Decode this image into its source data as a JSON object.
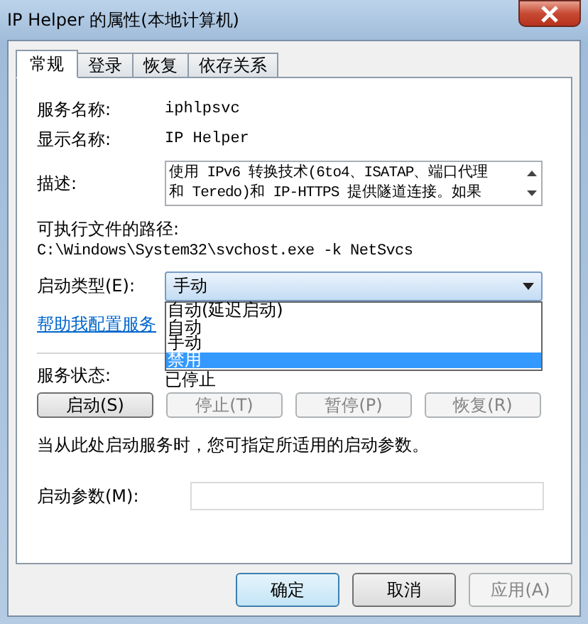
{
  "window": {
    "title": "IP Helper 的属性(本地计算机)"
  },
  "tabs": [
    {
      "label": "常规",
      "selected": true
    },
    {
      "label": "登录",
      "selected": false
    },
    {
      "label": "恢复",
      "selected": false
    },
    {
      "label": "依存关系",
      "selected": false
    }
  ],
  "service_name": {
    "label": "服务名称:",
    "value": "iphlpsvc"
  },
  "display_name": {
    "label": "显示名称:",
    "value": "IP Helper"
  },
  "description": {
    "label": "描述:",
    "lines": [
      "使用 IPv6 转换技术(6to4、ISATAP、端口代理",
      "和 Teredo)和 IP-HTTPS 提供隧道连接。如果"
    ]
  },
  "executable_path": {
    "label": "可执行文件的路径:",
    "value": "C:\\Windows\\System32\\svchost.exe -k NetSvcs"
  },
  "startup_type": {
    "label": "启动类型(E):",
    "value": "手动",
    "expanded": true,
    "options": [
      {
        "label": "自动(延迟启动)",
        "highlighted": false
      },
      {
        "label": "自动",
        "highlighted": false
      },
      {
        "label": "手动",
        "highlighted": false
      },
      {
        "label": "禁用",
        "highlighted": true
      }
    ]
  },
  "help_link": "帮助我配置服务",
  "service_status": {
    "label": "服务状态:",
    "value": "已停止"
  },
  "service_buttons": [
    {
      "label": "启动(S)",
      "disabled": false
    },
    {
      "label": "停止(T)",
      "disabled": true
    },
    {
      "label": "暂停(P)",
      "disabled": true
    },
    {
      "label": "恢复(R)",
      "disabled": true
    }
  ],
  "note": "当从此处启动服务时，您可指定所适用的启动参数。",
  "start_parameters": {
    "label": "启动参数(M):"
  },
  "dialog_buttons": [
    {
      "label": "确定",
      "default": true,
      "disabled": false
    },
    {
      "label": "取消",
      "default": false,
      "disabled": false
    },
    {
      "label": "应用(A)",
      "default": false,
      "disabled": true
    }
  ]
}
